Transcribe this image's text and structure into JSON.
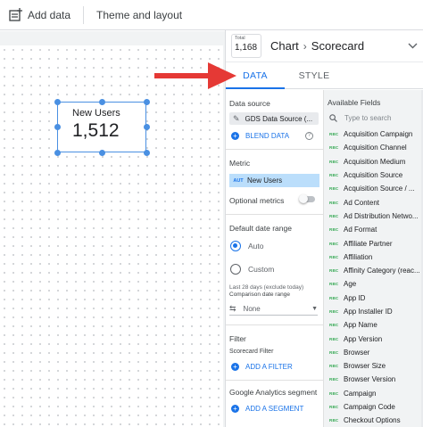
{
  "toolbar": {
    "add_data_label": "Add data",
    "theme_label": "Theme and layout"
  },
  "scorecard": {
    "label": "New Users",
    "value": "1,512"
  },
  "panel": {
    "type_caption": "Total",
    "type_value": "1,168",
    "breadcrumb_parent": "Chart",
    "breadcrumb_current": "Scorecard",
    "tabs": [
      {
        "label": "DATA",
        "active": true
      },
      {
        "label": "STYLE",
        "active": false
      }
    ]
  },
  "data_tab": {
    "data_source_title": "Data source",
    "data_source_name": "GDS Data Source (...",
    "blend_label": "BLEND DATA",
    "metric_title": "Metric",
    "metric_type": "AUT",
    "metric_name": "New Users",
    "optional_metrics_label": "Optional metrics",
    "date_range_title": "Default date range",
    "date_options": [
      {
        "label": "Auto",
        "selected": true
      },
      {
        "label": "Custom",
        "selected": false
      }
    ],
    "date_note": "Last 28 days (exclude today)",
    "comparison_label": "Comparison date range",
    "comparison_value": "None",
    "filter_title": "Filter",
    "scorecard_filter_title": "Scorecard Filter",
    "add_filter_label": "ADD A FILTER",
    "segment_title": "Google Analytics segment",
    "add_segment_label": "ADD A SEGMENT"
  },
  "fields": {
    "title": "Available Fields",
    "search_placeholder": "Type to search",
    "type_badge": "RBC",
    "items": [
      "Acquisition Campaign",
      "Acquisition Channel",
      "Acquisition Medium",
      "Acquisition Source",
      "Acquisition Source / ...",
      "Ad Content",
      "Ad Distribution Netwo...",
      "Ad Format",
      "Affiliate Partner",
      "Affiliation",
      "Affinity Category (reac...",
      "Age",
      "App ID",
      "App Installer ID",
      "App Name",
      "App Version",
      "Browser",
      "Browser Size",
      "Browser Version",
      "Campaign",
      "Campaign Code",
      "Checkout Options"
    ]
  },
  "colors": {
    "accent": "#1a73e8",
    "selection": "#4a90e2",
    "arrow": "#e53935",
    "metric_chip": "#bbdefb"
  }
}
